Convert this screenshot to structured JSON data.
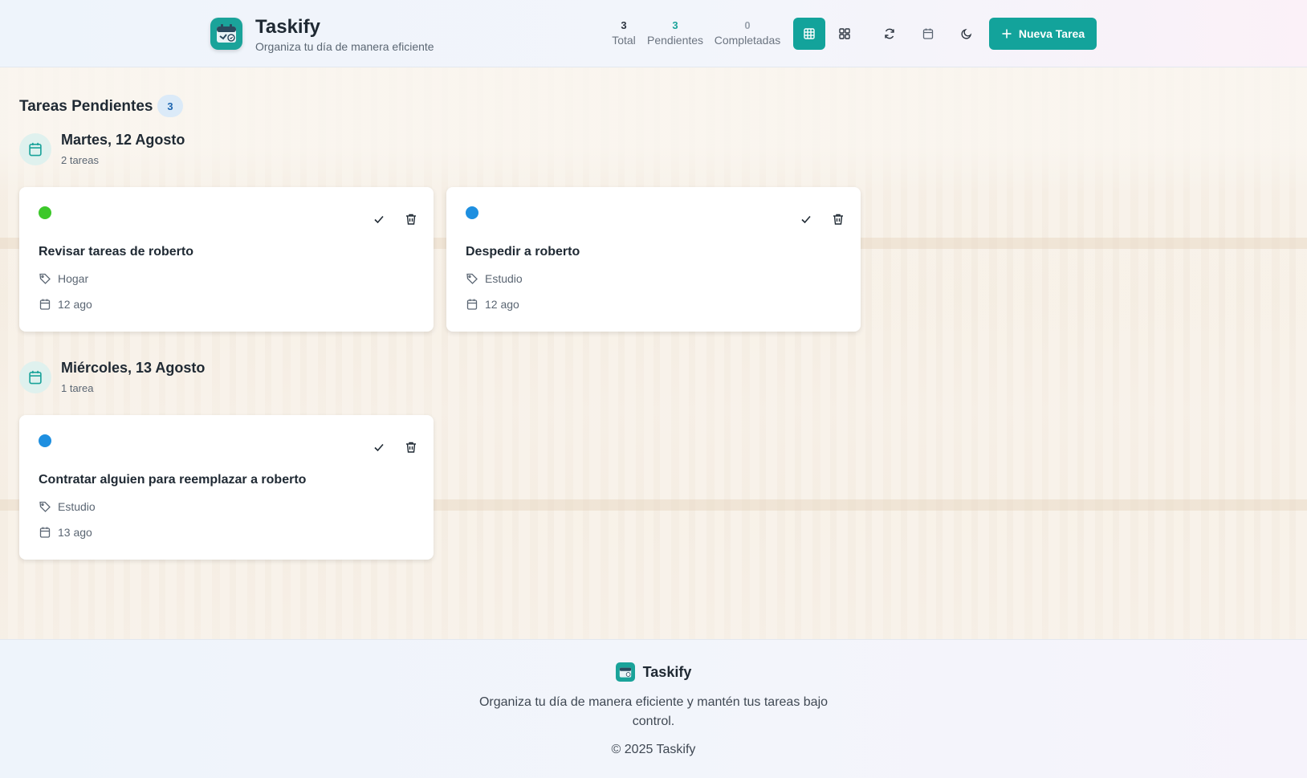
{
  "header": {
    "title": "Taskify",
    "subtitle": "Organiza tu día de manera eficiente",
    "stats": {
      "total": {
        "value": "3",
        "label": "Total"
      },
      "pending": {
        "value": "3",
        "label": "Pendientes"
      },
      "completed": {
        "value": "0",
        "label": "Completadas"
      }
    },
    "new_task_label": "Nueva Tarea",
    "accent_color": "#13a39b"
  },
  "main": {
    "section_title": "Tareas Pendientes",
    "section_count": "3",
    "days": [
      {
        "title": "Martes, 12 Agosto",
        "subtitle": "2 tareas",
        "tasks": [
          {
            "title": "Revisar tareas de roberto",
            "category": "Hogar",
            "date": "12 ago",
            "dot_color": "#3cc82a"
          },
          {
            "title": "Despedir a roberto",
            "category": "Estudio",
            "date": "12 ago",
            "dot_color": "#1e8fe0"
          }
        ]
      },
      {
        "title": "Miércoles, 13 Agosto",
        "subtitle": "1 tarea",
        "tasks": [
          {
            "title": "Contratar alguien para reemplazar a roberto",
            "category": "Estudio",
            "date": "13 ago",
            "dot_color": "#1e8fe0"
          }
        ]
      }
    ]
  },
  "footer": {
    "name": "Taskify",
    "description": "Organiza tu día de manera eficiente y mantén tus tareas bajo control.",
    "copyright": "© 2025 Taskify"
  }
}
